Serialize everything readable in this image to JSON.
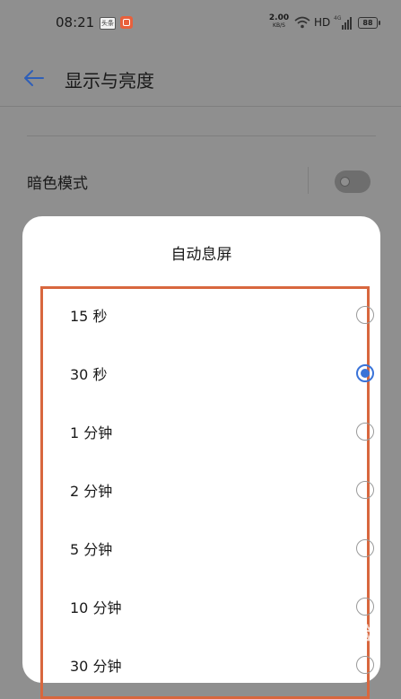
{
  "status_bar": {
    "time": "08:21",
    "notif_1": "头条",
    "net_speed_value": "2.00",
    "net_speed_unit": "KB/S",
    "hd": "HD",
    "battery": "88",
    "icons": [
      "app-notification-icon",
      "app-notification-icon",
      "wifi-icon",
      "signal-4g-icon",
      "battery-icon"
    ]
  },
  "header": {
    "title": "显示与亮度",
    "back_icon": "back-arrow-icon"
  },
  "settings": {
    "dark_mode_label": "暗色模式",
    "dark_mode_on": false
  },
  "dialog": {
    "title": "自动息屏",
    "options": [
      {
        "label": "15 秒",
        "checked": false
      },
      {
        "label": "30 秒",
        "checked": true
      },
      {
        "label": "1 分钟",
        "checked": false
      },
      {
        "label": "2 分钟",
        "checked": false
      },
      {
        "label": "5 分钟",
        "checked": false
      },
      {
        "label": "10 分钟",
        "checked": false
      },
      {
        "label": "30 分钟",
        "checked": false
      }
    ]
  },
  "watermark": "Bai 经验",
  "colors": {
    "accent": "#3a73d8",
    "highlight_border": "#d8673e",
    "scrim": "#8f8f8f"
  }
}
